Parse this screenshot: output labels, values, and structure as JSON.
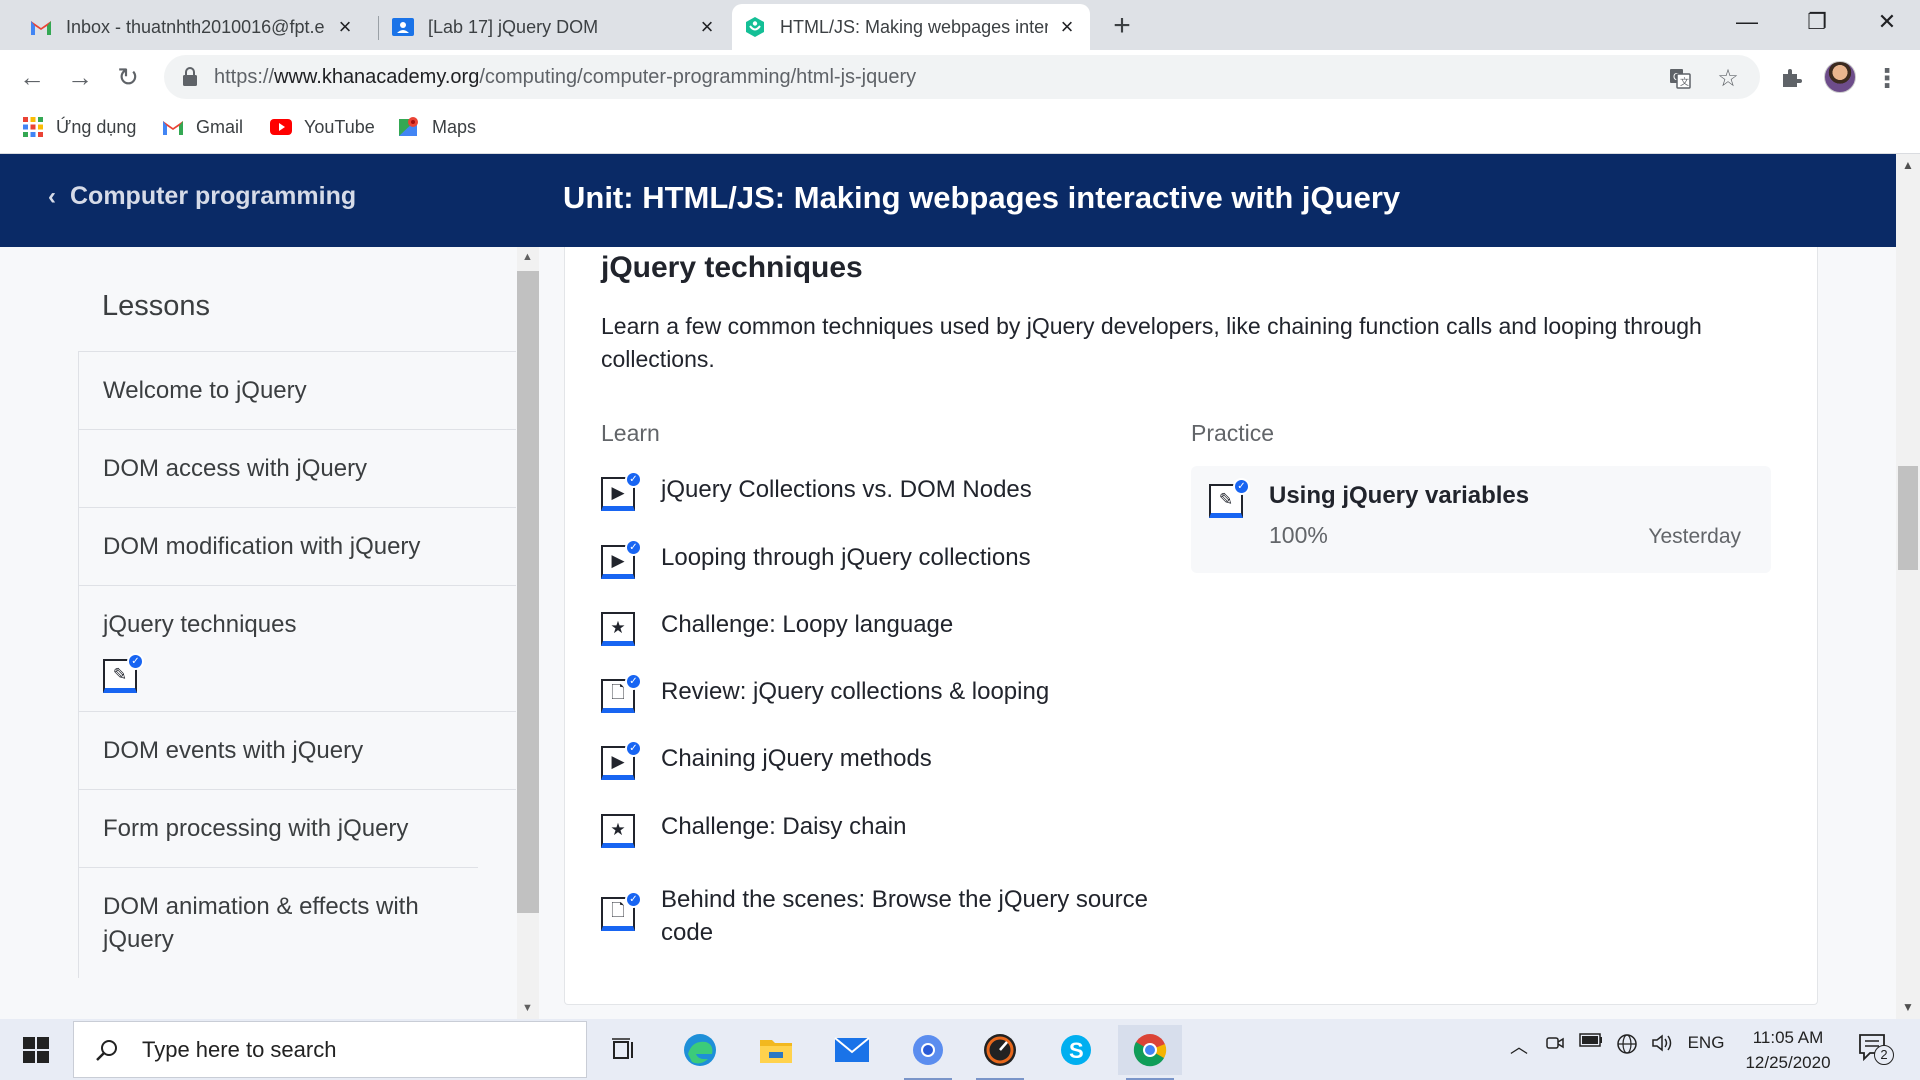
{
  "browser": {
    "tabs": [
      {
        "title": "Inbox - thuatnhth2010016@fpt.e",
        "icon": "gmail-icon",
        "active": false
      },
      {
        "title": "[Lab 17] jQuery DOM",
        "icon": "classroom-icon",
        "active": false
      },
      {
        "title": "HTML/JS: Making webpages inter",
        "icon": "khan-academy-icon",
        "active": true
      }
    ],
    "url": {
      "protocol": "https://",
      "host": "www.khanacademy.org",
      "path": "/computing/computer-programming/html-js-jquery"
    },
    "bookmarks": [
      {
        "label": "Ứng dụng",
        "icon": "apps-grid-icon"
      },
      {
        "label": "Gmail",
        "icon": "gmail-icon"
      },
      {
        "label": "YouTube",
        "icon": "youtube-icon"
      },
      {
        "label": "Maps",
        "icon": "maps-icon"
      }
    ]
  },
  "header": {
    "back_label": "Computer programming",
    "unit_title": "Unit: HTML/JS: Making webpages interactive with jQuery"
  },
  "sidebar": {
    "title": "Lessons",
    "items": [
      {
        "label": "Welcome to jQuery"
      },
      {
        "label": "DOM access with jQuery"
      },
      {
        "label": "DOM modification with jQuery"
      },
      {
        "label": "jQuery techniques",
        "current": true
      },
      {
        "label": "DOM events with jQuery"
      },
      {
        "label": "Form processing with jQuery"
      },
      {
        "label": "DOM animation & effects with jQuery"
      }
    ]
  },
  "lesson": {
    "title": "jQuery techniques",
    "description": "Learn a few common techniques used by jQuery developers, like chaining function calls and looping through collections.",
    "learn_label": "Learn",
    "practice_label": "Practice",
    "learn_items": [
      {
        "label": "jQuery Collections vs. DOM Nodes",
        "icon": "video-icon",
        "completed": true
      },
      {
        "label": "Looping through jQuery collections",
        "icon": "video-icon",
        "completed": true
      },
      {
        "label": "Challenge: Loopy language",
        "icon": "star-icon",
        "completed": false
      },
      {
        "label": "Review: jQuery collections & looping",
        "icon": "article-icon",
        "completed": true
      },
      {
        "label": "Chaining jQuery methods",
        "icon": "video-icon",
        "completed": true
      },
      {
        "label": "Challenge: Daisy chain",
        "icon": "star-icon",
        "completed": false
      },
      {
        "label": "Behind the scenes: Browse the jQuery source code",
        "icon": "article-icon",
        "completed": true
      }
    ],
    "practice": {
      "title": "Using jQuery variables",
      "percent": "100%",
      "when": "Yesterday",
      "icon": "pencil-icon"
    }
  },
  "taskbar": {
    "search_placeholder": "Type here to search",
    "language": "ENG",
    "time": "11:05 AM",
    "date": "12/25/2020",
    "notification_count": "2"
  },
  "colors": {
    "khan_navy": "#0a2a66",
    "khan_blue": "#1865f2",
    "text_dark": "#21242c",
    "text_muted": "#626569"
  }
}
